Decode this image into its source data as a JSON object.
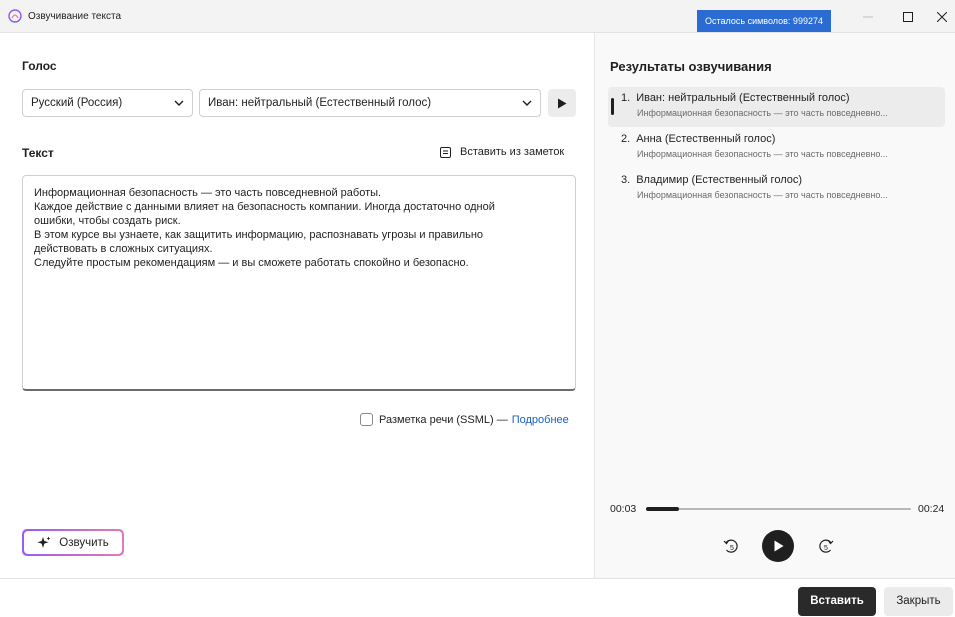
{
  "window": {
    "title": "Озвучивание текста",
    "chars_left": "Осталось символов: 999274"
  },
  "voice": {
    "label": "Голос",
    "language": "Русский (Россия)",
    "voice_name": "Иван: нейтральный (Естественный голос)"
  },
  "text_section": {
    "label": "Текст",
    "insert_from_notes": "Вставить из заметок",
    "content": [
      "Информационная безопасность — это часть повседневной работы.",
      "Каждое действие с данными влияет на безопасность компании. Иногда достаточно одной",
      "ошибки, чтобы создать риск.",
      "В этом курсе вы узнаете, как защитить информацию, распознавать угрозы и правильно",
      "действовать в сложных ситуациях.",
      "Следуйте простым рекомендациям — и вы сможете работать спокойно и безопасно."
    ]
  },
  "ssml": {
    "label": "Разметка речи (SSML) —",
    "link": "Подробнее",
    "checked": false
  },
  "speak_button": "Озвучить",
  "results": {
    "title": "Результаты озвучивания",
    "items": [
      {
        "num": "1.",
        "name": "Иван: нейтральный (Естественный голос)",
        "snippet": "Информационная безопасность — это часть повседневно..."
      },
      {
        "num": "2.",
        "name": "Анна (Естественный голос)",
        "snippet": "Информационная безопасность — это часть повседневно..."
      },
      {
        "num": "3.",
        "name": "Владимир (Естественный голос)",
        "snippet": "Информационная безопасность — это часть повседневно..."
      }
    ]
  },
  "player": {
    "current": "00:03",
    "total": "00:24",
    "progress": 0.125,
    "rewind_label": "5",
    "forward_label": "5"
  },
  "footer": {
    "insert": "Вставить",
    "close": "Закрыть"
  },
  "colors": {
    "accent": "#2b6cd4",
    "link": "#1b5fc1",
    "primary_button": "#2a2a2a"
  }
}
